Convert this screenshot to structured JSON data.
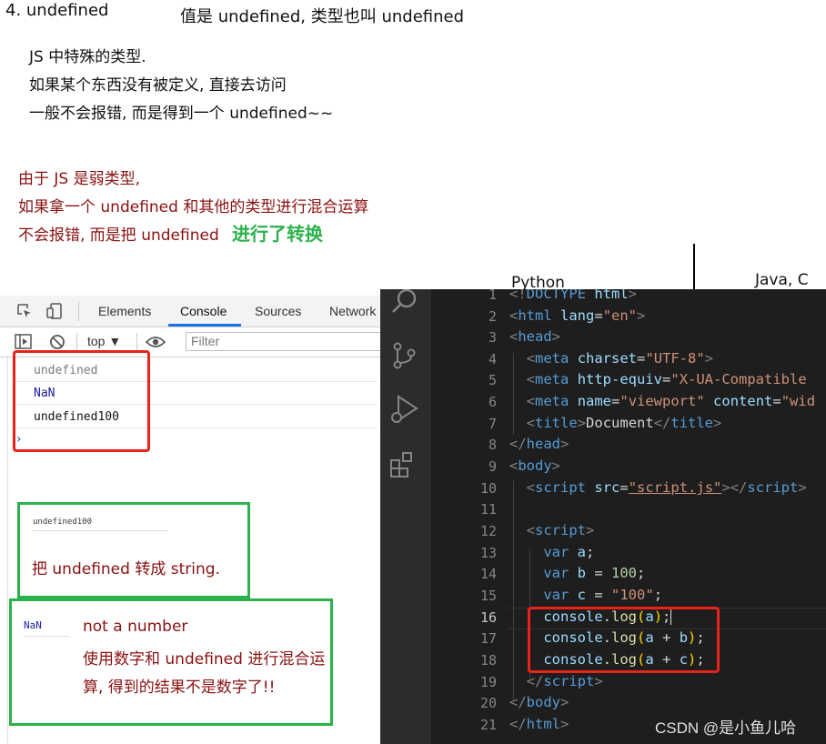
{
  "notes": {
    "heading": "4. undefined",
    "value_desc": "值是 undefined, 类型也叫 undefined",
    "lines": [
      "JS 中特殊的类型.",
      "如果某个东西没有被定义, 直接去访问",
      "一般不会报错, 而是得到一个 undefined~~"
    ],
    "red_lines": [
      "由于 JS 是弱类型,",
      "如果拿一个 undefined 和其他的类型进行混合运算",
      "不会报错, 而是把 undefined "
    ],
    "red_highlight": "进行了转换",
    "table_python": "Python",
    "table_java": "Java, C"
  },
  "devtools": {
    "tabs": [
      "Elements",
      "Console",
      "Sources",
      "Network"
    ],
    "active_tab": "Console",
    "context": "top ▼",
    "filter_placeholder": "Filter",
    "console_output": [
      "undefined",
      "NaN",
      "undefined100"
    ],
    "prompt": "›"
  },
  "callouts": {
    "string": {
      "mini": "undefined100",
      "text": "把 undefined 转成 string."
    },
    "nan": {
      "mini": "NaN",
      "title": "not a number",
      "line1": "使用数字和 undefined 进行混合运",
      "line2": "算, 得到的结果不是数字了!!"
    }
  },
  "editor": {
    "line_numbers": [
      "1",
      "2",
      "3",
      "4",
      "5",
      "6",
      "7",
      "8",
      "9",
      "10",
      "11",
      "12",
      "13",
      "14",
      "15",
      "16",
      "17",
      "18",
      "19",
      "20",
      "21"
    ],
    "current_line": "16"
  },
  "colors": {
    "annotation_red": "#e8231a",
    "annotation_green": "#2bb24c",
    "note_text_red": "#8a1111"
  },
  "watermark": "CSDN @是小鱼儿哈"
}
